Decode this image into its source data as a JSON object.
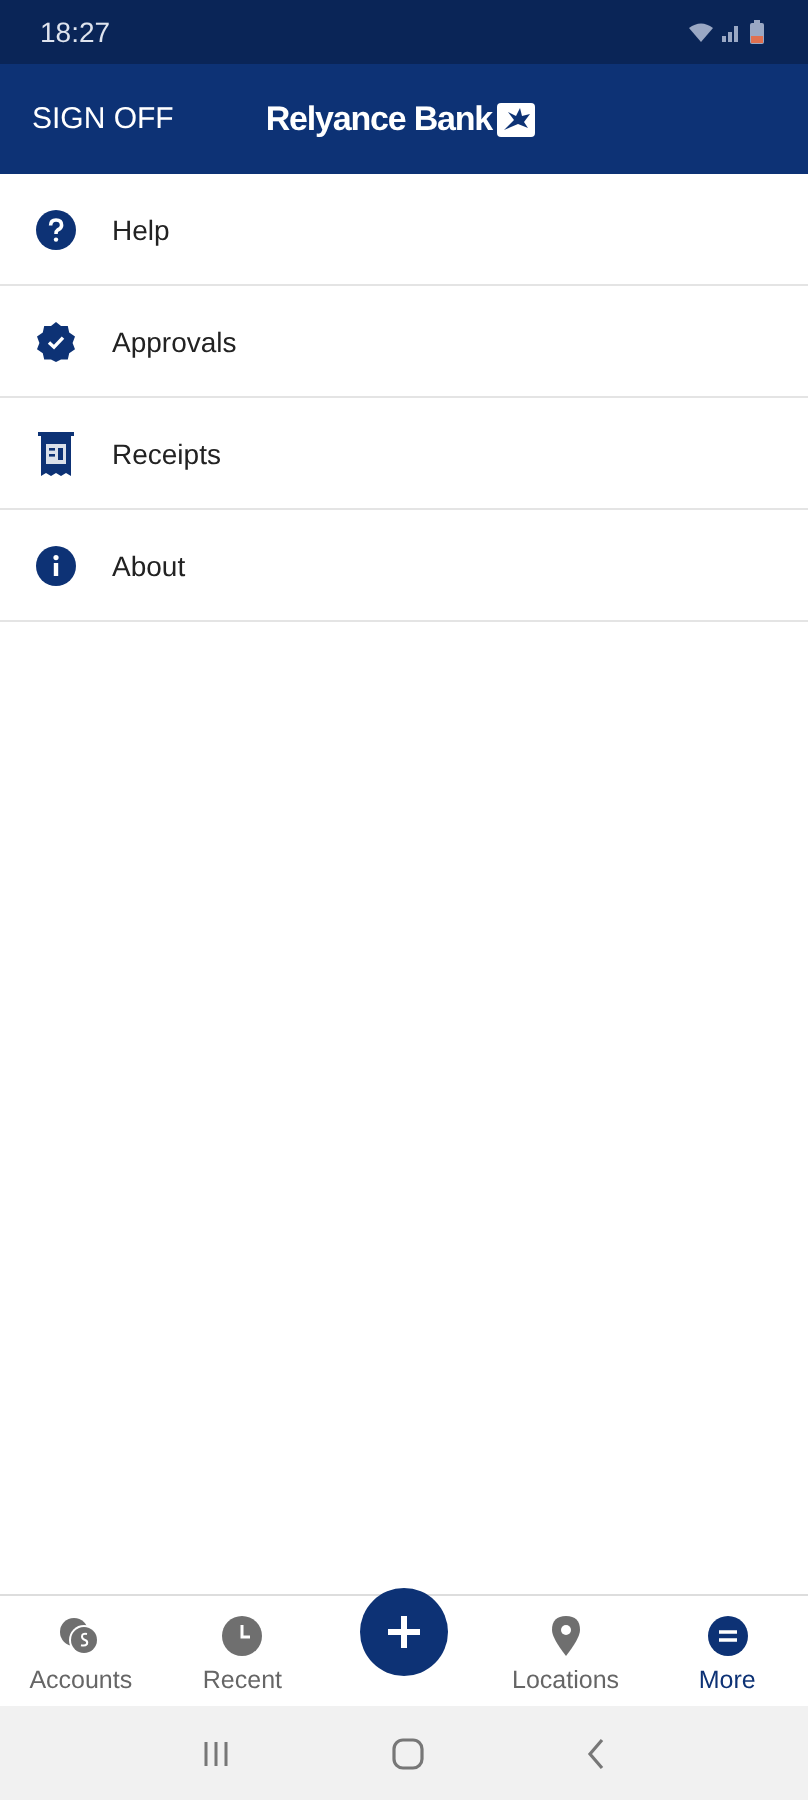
{
  "status_bar": {
    "time": "18:27"
  },
  "header": {
    "sign_off": "SIGN OFF",
    "logo_text": "Relyance Bank"
  },
  "menu": [
    {
      "label": "Help",
      "kind": "help"
    },
    {
      "label": "Approvals",
      "kind": "approvals"
    },
    {
      "label": "Receipts",
      "kind": "receipts"
    },
    {
      "label": "About",
      "kind": "about"
    }
  ],
  "tab_bar": [
    {
      "kind": "accounts",
      "label": "Accounts",
      "selected": false
    },
    {
      "kind": "recent",
      "label": "Recent",
      "selected": false
    },
    {
      "kind": "add"
    },
    {
      "kind": "locations",
      "label": "Locations",
      "selected": false
    },
    {
      "kind": "more",
      "label": "More",
      "selected": true
    }
  ]
}
